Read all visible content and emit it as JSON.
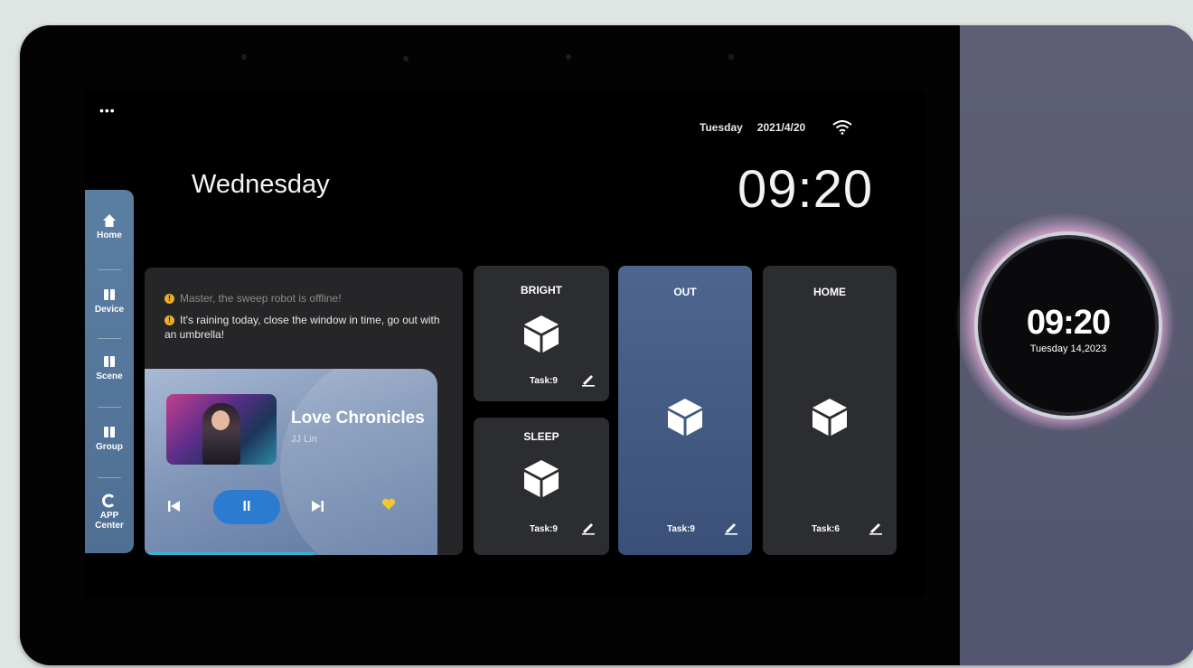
{
  "status_bar": {
    "day": "Tuesday",
    "date": "2021/4/20"
  },
  "menu": {
    "label": "•••"
  },
  "clock": {
    "time": "09:20"
  },
  "greeting": {
    "day": "Wednesday"
  },
  "sidebar": {
    "items": [
      {
        "label": "Home",
        "icon": "home-icon"
      },
      {
        "label": "Device",
        "icon": "device-icon"
      },
      {
        "label": "Scene",
        "icon": "scene-icon"
      },
      {
        "label": "Group",
        "icon": "group-icon"
      },
      {
        "label": "APP Center",
        "icon": "app-center-icon"
      }
    ]
  },
  "notices": [
    {
      "text": "Master, the sweep robot is offline!",
      "icon": "!"
    },
    {
      "text": "It's raining today, close the window in time, go out with an umbrella!",
      "icon": "!"
    }
  ],
  "music": {
    "title": "Love Chronicles",
    "artist": "JJ Lin",
    "play_glyph": "II",
    "progress_fraction": 0.58
  },
  "scenes": [
    {
      "name": "BRIGHT",
      "task": "Task:9"
    },
    {
      "name": "SLEEP",
      "task": "Task:9"
    },
    {
      "name": "OUT",
      "task": "Task:9"
    },
    {
      "name": "HOME",
      "task": "Task:6"
    }
  ],
  "knob": {
    "time": "09:20",
    "date": "Tuesday 14,2023"
  },
  "colors": {
    "sidebar": "#5b7fa3",
    "active_scene": "#4d6690",
    "play_button": "#2b7bd0",
    "notice_icon": "#e8b02a",
    "heart": "#f2c62e",
    "progress": "#2fb6d6"
  }
}
